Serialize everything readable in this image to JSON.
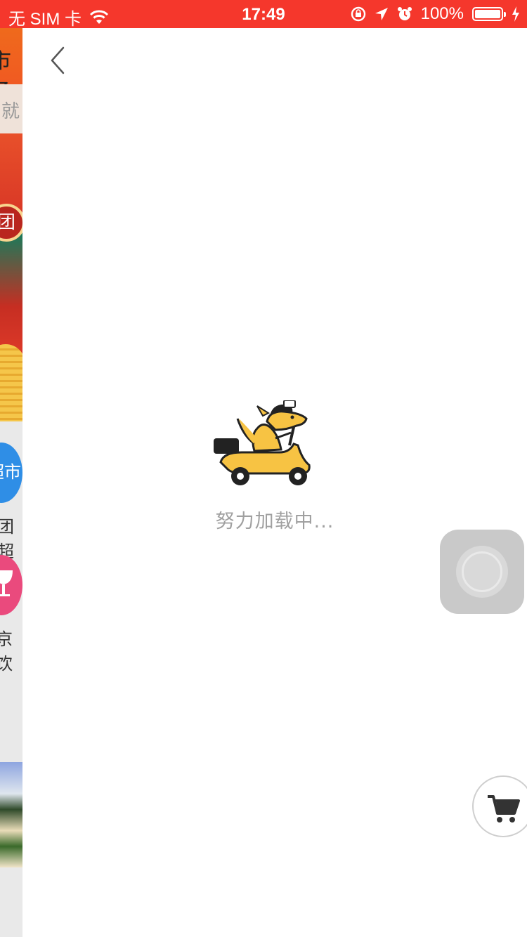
{
  "status_bar": {
    "carrier": "无 SIM 卡",
    "time": "17:49",
    "battery": "100%",
    "background": "#f5372c"
  },
  "background_page": {
    "header_text": "市场",
    "search_text": "就",
    "banner_badge": "团",
    "category_1_label": "团超",
    "category_1_icon_text": "超市",
    "category_2_label": "京饮"
  },
  "panel": {
    "back_icon": "chevron-left-icon",
    "loading_text": "努力加载中...",
    "loading_icon": "kangaroo-scooter-icon",
    "cart_icon": "shopping-cart-icon",
    "accent_color": "#f7c343"
  }
}
